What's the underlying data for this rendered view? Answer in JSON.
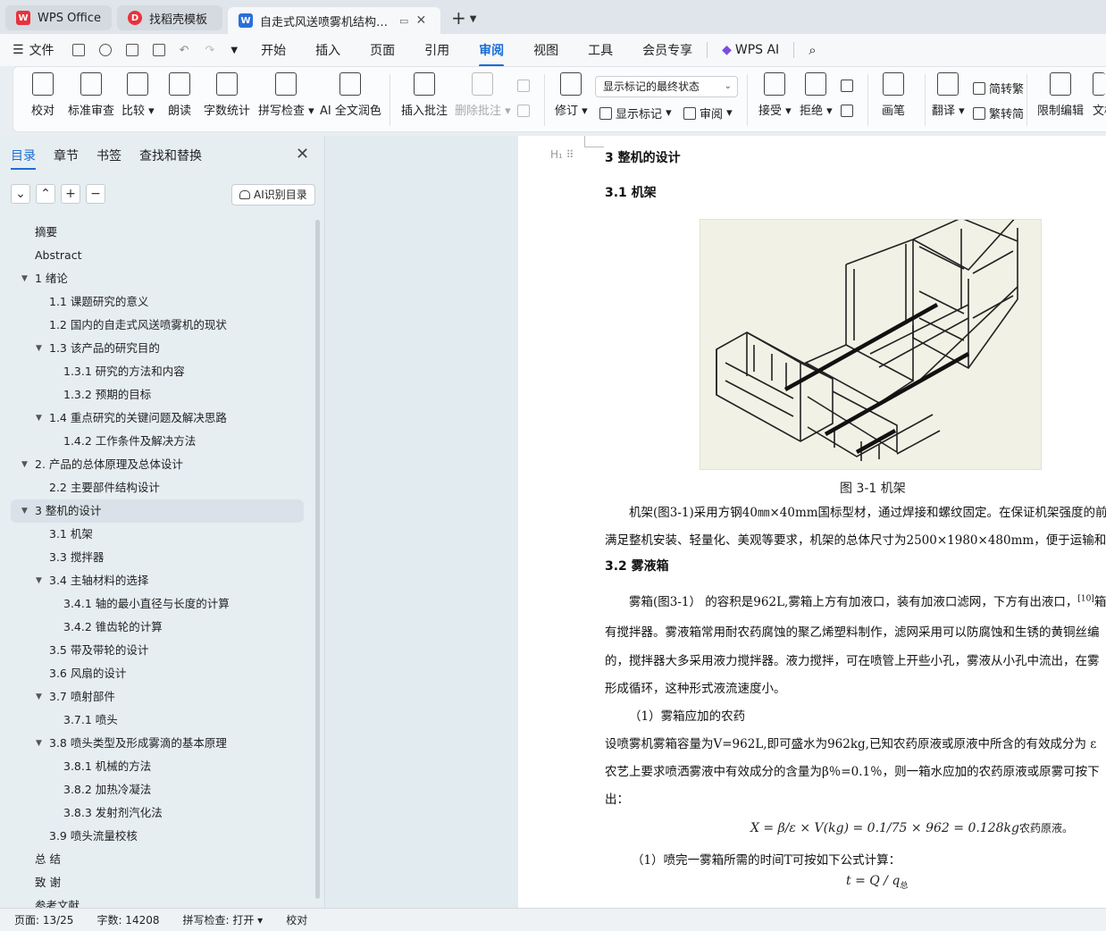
{
  "tabs": {
    "wps": "WPS Office",
    "templates": "找稻壳模板",
    "document": "自走式风送喷雾机结构设计 论"
  },
  "menu": {
    "file": "文件",
    "items": [
      "开始",
      "插入",
      "页面",
      "引用",
      "审阅",
      "视图",
      "工具",
      "会员专享"
    ],
    "active": "审阅",
    "ai": "WPS AI"
  },
  "ribbon": {
    "proofread": "校对",
    "std_review": "标准审查",
    "compare": "比较",
    "read_aloud": "朗读",
    "word_count": "字数统计",
    "spell_check": "拼写检查",
    "ai_polish": "AI 全文润色",
    "insert_comment": "插入批注",
    "delete_comment": "删除批注",
    "track": "修订",
    "show_markup_select": "显示标记的最终状态",
    "show_markup": "显示标记",
    "review": "审阅",
    "accept": "接受",
    "reject": "拒绝",
    "pen": "画笔",
    "translate": "翻译",
    "to_trad": "简转繁",
    "to_simp": "繁转简",
    "restrict": "限制编辑",
    "doc_cut": "文档"
  },
  "leftpanel": {
    "tabs": [
      "目录",
      "章节",
      "书签",
      "查找和替换"
    ],
    "ai_button": "AI识别目录",
    "toc": [
      {
        "text": "摘要",
        "level": 0,
        "arrow": false
      },
      {
        "text": "Abstract",
        "level": 0,
        "arrow": false
      },
      {
        "text": "1  绪论",
        "level": 0,
        "arrow": true
      },
      {
        "text": "1.1 课题研究的意义",
        "level": 1,
        "arrow": false
      },
      {
        "text": "1.2 国内的自走式风送喷雾机的现状",
        "level": 1,
        "arrow": false
      },
      {
        "text": "1.3  该产品的研究目的",
        "level": 1,
        "arrow": true
      },
      {
        "text": "1.3.1  研究的方法和内容",
        "level": 2,
        "arrow": false
      },
      {
        "text": "1.3.2 预期的目标",
        "level": 2,
        "arrow": false
      },
      {
        "text": "1.4 重点研究的关键问题及解决思路",
        "level": 1,
        "arrow": true
      },
      {
        "text": "1.4.2 工作条件及解决方法",
        "level": 2,
        "arrow": false
      },
      {
        "text": "2. 产品的总体原理及总体设计",
        "level": 0,
        "arrow": true
      },
      {
        "text": "2.2  主要部件结构设计",
        "level": 1,
        "arrow": false
      },
      {
        "text": "3  整机的设计",
        "level": 0,
        "arrow": true,
        "selected": true
      },
      {
        "text": "3.1  机架",
        "level": 1,
        "arrow": false
      },
      {
        "text": "3.3  搅拌器",
        "level": 1,
        "arrow": false
      },
      {
        "text": "3.4  主轴材料的选择",
        "level": 1,
        "arrow": true
      },
      {
        "text": "3.4.1  轴的最小直径与长度的计算",
        "level": 2,
        "arrow": false
      },
      {
        "text": "3.4.2  锥齿轮的计算",
        "level": 2,
        "arrow": false
      },
      {
        "text": "3.5  带及带轮的设计",
        "level": 1,
        "arrow": false
      },
      {
        "text": "3.6  风扇的设计",
        "level": 1,
        "arrow": false
      },
      {
        "text": "3.7 喷射部件",
        "level": 1,
        "arrow": true
      },
      {
        "text": "3.7.1  喷头",
        "level": 2,
        "arrow": false
      },
      {
        "text": "3.8 喷头类型及形成雾滴的基本原理",
        "level": 1,
        "arrow": true
      },
      {
        "text": "3.8.1  机械的方法",
        "level": 2,
        "arrow": false
      },
      {
        "text": "3.8.2  加热冷凝法",
        "level": 2,
        "arrow": false
      },
      {
        "text": "3.8.3  发射剂汽化法",
        "level": 2,
        "arrow": false
      },
      {
        "text": "3.9  喷头流量校核",
        "level": 1,
        "arrow": false
      },
      {
        "text": "总   结",
        "level": 0,
        "arrow": false
      },
      {
        "text": "致   谢",
        "level": 0,
        "arrow": false
      },
      {
        "text": "参考文献",
        "level": 0,
        "arrow": false
      }
    ]
  },
  "document": {
    "h3": "3  整机的设计",
    "h31": "3.1  机架",
    "caption": "图  3-1  机架",
    "p1a": "机架(图3-1)采用方钢40㎜×40mm国标型材，通过焊接和螺纹固定。在保证机架强度的前",
    "p1b": "满足整机安装、轻量化、美观等要求，机架的总体尺寸为2500×1980×480mm，便于运输和摆",
    "h32": "3.2  雾液箱",
    "p2a": "雾箱(图3-1）  的容积是962L,雾箱上方有加液口，装有加液口滤网，下方有出液口，",
    "p2a_ref": "[10]",
    "p2a_tail": "箱",
    "p2b": "有搅拌器。雾液箱常用耐农药腐蚀的聚乙烯塑料制作，滤网采用可以防腐蚀和生锈的黄铜丝编",
    "p2c": "的，搅拌器大多采用液力搅拌器。液力搅拌，可在喷管上开些小孔，雾液从小孔中流出，在雾",
    "p2d": "形成循环，这种形式液流速度小。",
    "item1": "（1）雾箱应加的农药",
    "p3a": "设喷雾机雾箱容量为V=962L,即可盛水为962kg,已知农药原液或原液中所含的有效成分为 ε",
    "p3b": "农艺上要求喷洒雾液中有效成分的含量为β％=0.1％，则一箱水应加的农药原液或原雾可按下",
    "p3c": "出：",
    "formula1": "X = β/ε × V(kg) = 0.1/75 × 962 = 0.128kg",
    "formula1_tail": "农药原液。",
    "item2": "（1）喷完一雾箱所需的时间T可按如下公式计算：",
    "formula2": "t = Q / q",
    "formula2_sub": "总"
  },
  "status": {
    "page": "页面: 13/25",
    "words": "字数: 14208",
    "spell": "拼写检查: 打开",
    "proof": "校对"
  }
}
